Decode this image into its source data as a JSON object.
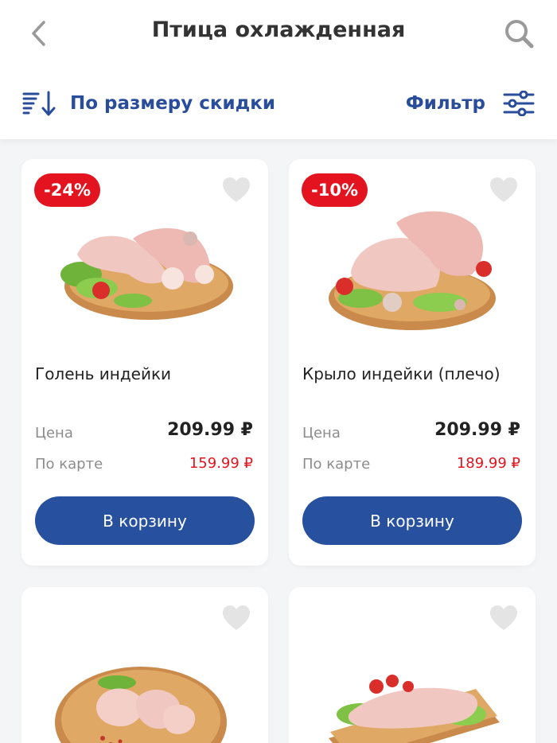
{
  "header": {
    "title": "Птица охлажденная",
    "sort_label": "По размеру скидки",
    "filter_label": "Фильтр"
  },
  "colors": {
    "accent": "#27509e",
    "discount": "#e3141f"
  },
  "products": [
    {
      "discount": "-24%",
      "name": "Голень индейки",
      "price_label": "Цена",
      "price": "209.99 ₽",
      "card_label": "По карте",
      "card_price": "159.99 ₽",
      "button": "В корзину"
    },
    {
      "discount": "-10%",
      "name": "Крыло индейки (плечо)",
      "price_label": "Цена",
      "price": "209.99 ₽",
      "card_label": "По карте",
      "card_price": "189.99 ₽",
      "button": "В корзину"
    }
  ]
}
